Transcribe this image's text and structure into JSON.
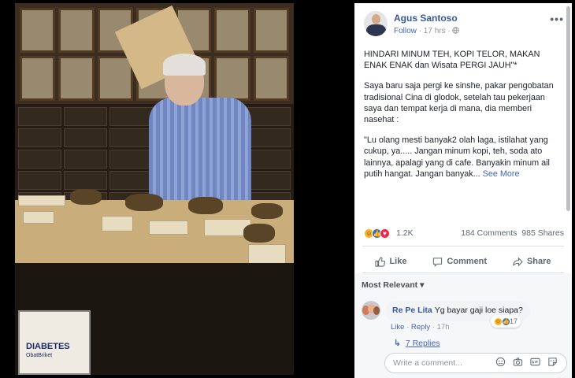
{
  "author": {
    "name": "Agus Santoso",
    "follow_label": "Follow",
    "time": "17 hrs",
    "privacy_icon": "globe-icon"
  },
  "post": {
    "paragraphs": [
      "HINDARI MINUM TEH, KOPI TELOR, MAKAN ENAK ENAK dan Wisata PERGI JAUH\"*",
      "Saya baru saja pergi ke sinshe, pakar pengobatan tradisional Cina di glodok, setelah tau pekerjaan saya dan tempat kerja di mana, dia memberi nasehat :",
      "\"Lu olang mesti banyak2 olah laga, istilahat yang cukup, ya..... Jangan minum kopi, teh, soda ato lainnya, apalagi yang di cafe. Banyakin minum ail putih hangat. Jangan banyak..."
    ],
    "see_more_label": "See More"
  },
  "stats": {
    "reactions_count": "1.2K",
    "comments": "184 Comments",
    "shares": "985 Shares"
  },
  "actions": {
    "like": "Like",
    "comment": "Comment",
    "share": "Share"
  },
  "filter": {
    "label": "Most Relevant ▾"
  },
  "comment": {
    "author": "Re Pe Lita",
    "text": "Yg bayar gaji loe siapa?",
    "like_label": "Like",
    "reply_label": "Reply",
    "time": "17h",
    "reaction_count": "17",
    "replies_label": "7 Replies"
  },
  "composer": {
    "placeholder": "Write a comment..."
  },
  "photo": {
    "poster_text": "DIABETES",
    "poster_sub": "ObatBriket"
  },
  "colors": {
    "link": "#365899",
    "accent": "#4267b2",
    "muted": "#90949c"
  }
}
